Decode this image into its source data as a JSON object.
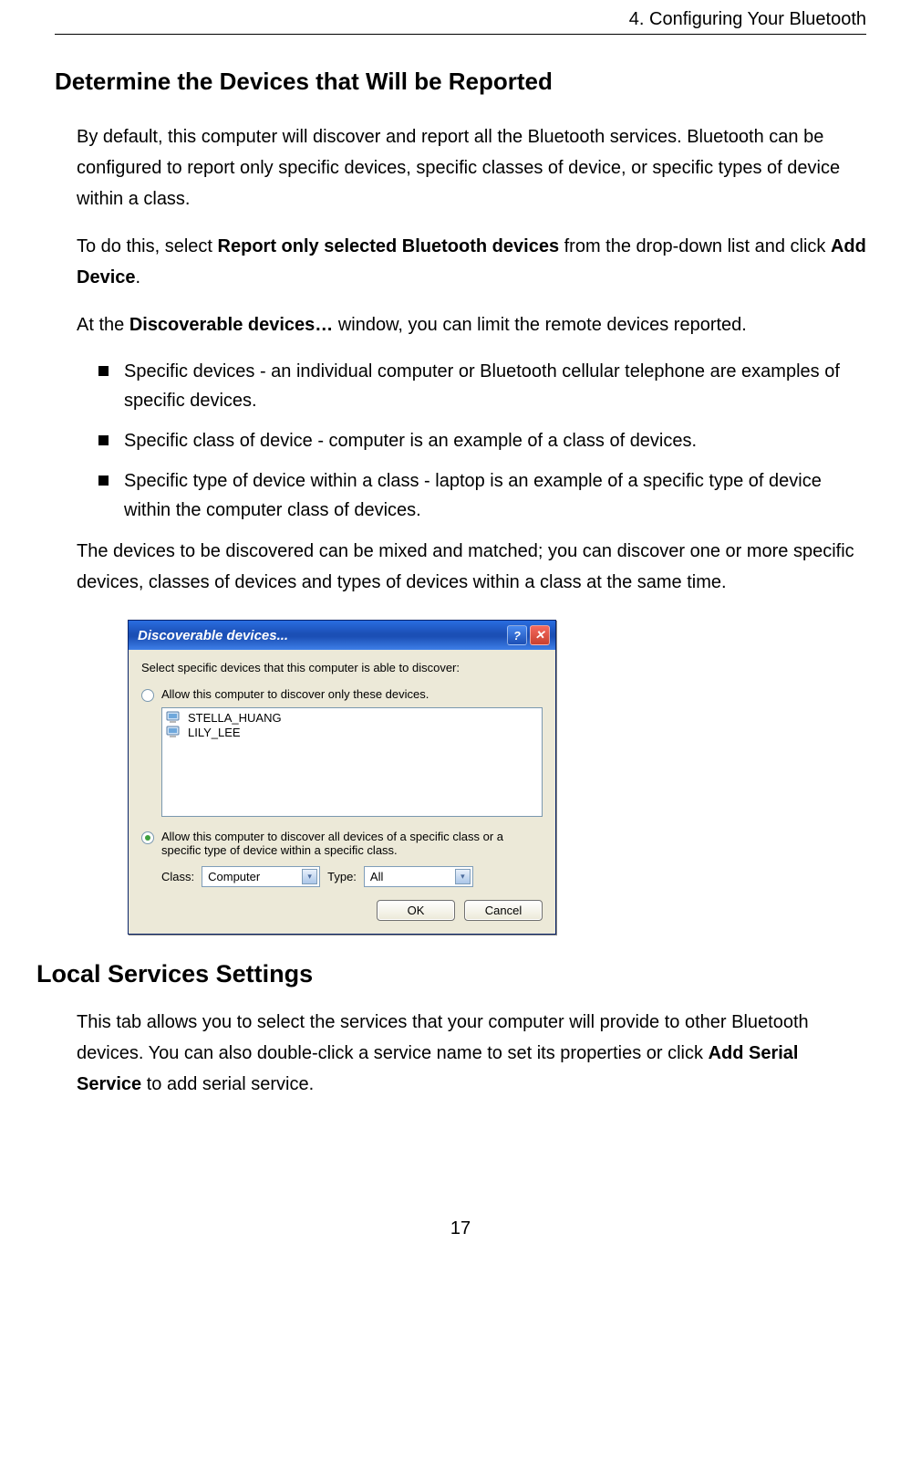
{
  "header": {
    "chapter": "4. Configuring Your Bluetooth"
  },
  "section1": {
    "title": "Determine the Devices that Will be Reported",
    "p1": "By default, this computer will discover and report all the Bluetooth services. Bluetooth can be configured to report only specific devices, specific classes of device, or specific types of device within a class.",
    "p2_pre": "To do this, select ",
    "p2_bold1": "Report only selected Bluetooth devices",
    "p2_mid": " from the drop-down list and click ",
    "p2_bold2": "Add Device",
    "p2_post": ".",
    "p3_pre": "At the ",
    "p3_bold": "Discoverable devices…",
    "p3_post": " window, you can limit the remote devices reported.",
    "bullets": [
      "Specific devices - an individual computer or Bluetooth cellular telephone are examples of specific devices.",
      "Specific class of device - computer is an example of a class of devices.",
      "Specific type of device within a class - laptop is an example of a specific type of device within the computer class of devices."
    ],
    "p4": "The devices to be discovered can be mixed and matched; you can discover one or more specific devices, classes of devices and types of devices within a class at the same time."
  },
  "dialog": {
    "title": "Discoverable devices...",
    "help_symbol": "?",
    "close_symbol": "✕",
    "instruction": "Select specific devices that this computer is able to discover:",
    "radio1": "Allow this computer to discover only these devices.",
    "devices": [
      "STELLA_HUANG",
      "LILY_LEE"
    ],
    "radio2": "Allow this computer to discover all devices of a specific class or a specific type of device within a specific class.",
    "class_label": "Class:",
    "class_value": "Computer",
    "type_label": "Type:",
    "type_value": "All",
    "ok": "OK",
    "cancel": "Cancel"
  },
  "section2": {
    "title": "Local Services Settings",
    "p1_pre": "This tab allows you to select the services that your computer will provide to other Bluetooth devices. You can also double-click a service name to set its properties or click ",
    "p1_bold": "Add Serial Service",
    "p1_post": " to add serial service."
  },
  "page_number": "17"
}
